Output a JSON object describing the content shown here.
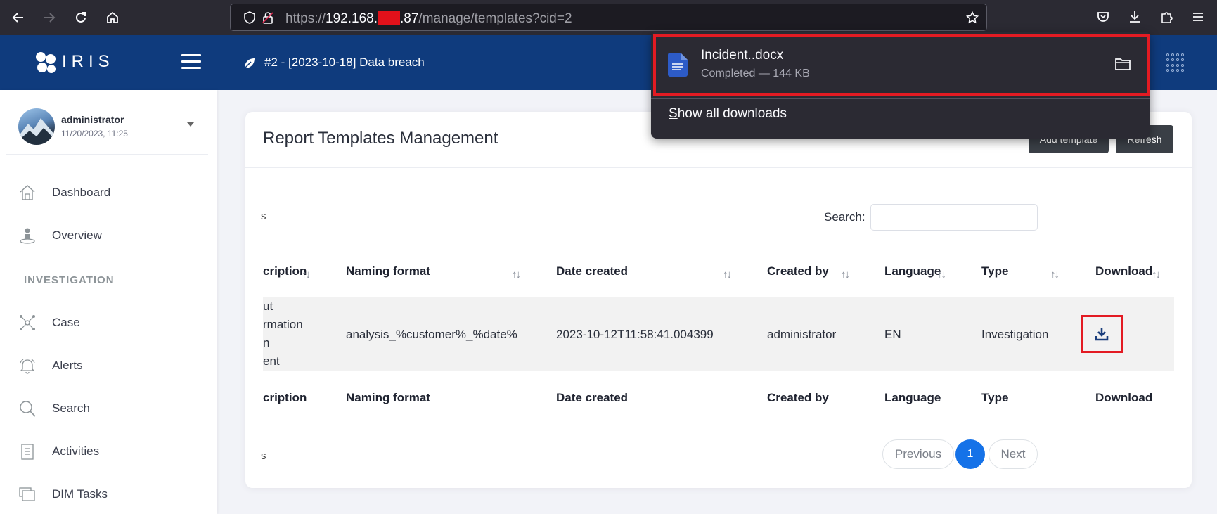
{
  "browser": {
    "url_prefix": "https://",
    "url_host_start": "192.168.",
    "url_host_end": ".87",
    "url_path": "/manage/templates?cid=2"
  },
  "header": {
    "logo_text": "IRIS",
    "case_title": "#2 - [2023-10-18] Data breach"
  },
  "user": {
    "name": "administrator",
    "date": "11/20/2023, 11:25"
  },
  "sidebar": {
    "items": [
      {
        "label": "Dashboard",
        "icon": "home-icon"
      },
      {
        "label": "Overview",
        "icon": "overview-icon"
      }
    ],
    "section_title": "INVESTIGATION",
    "investigation_items": [
      {
        "label": "Case",
        "icon": "case-network-icon"
      },
      {
        "label": "Alerts",
        "icon": "bell-icon"
      },
      {
        "label": "Search",
        "icon": "search-icon"
      },
      {
        "label": "Activities",
        "icon": "clipboard-icon"
      },
      {
        "label": "DIM Tasks",
        "icon": "stacked-windows-icon"
      }
    ]
  },
  "page": {
    "title": "Report Templates Management",
    "add_button": "Add template",
    "refresh_button": "Refresh",
    "length_fragment": "s",
    "search_label": "Search:",
    "search_value": "",
    "info_fragment": "s"
  },
  "table": {
    "columns": [
      "cription",
      "Naming format",
      "Date created",
      "Created by",
      "Language",
      "Type",
      "Download"
    ],
    "sort_glyph": "↑↓",
    "row": {
      "description_lines": [
        "ut",
        "rmation",
        "n",
        "ent"
      ],
      "naming_format": "analysis_%customer%_%date%",
      "date_created": "2023-10-12T11:58:41.004399",
      "created_by": "administrator",
      "language": "EN",
      "type": "Investigation"
    }
  },
  "pagination": {
    "previous": "Previous",
    "current": "1",
    "next": "Next"
  },
  "downloads": {
    "filename": "Incident..docx",
    "status": "Completed — 144 KB",
    "show_all_prefix": "S",
    "show_all_rest": "how all downloads"
  },
  "colors": {
    "header_bg": "#0f3b7d",
    "accent_blue": "#1572e8",
    "highlight_red": "#e31b23",
    "browser_bg": "#2b2a33"
  }
}
